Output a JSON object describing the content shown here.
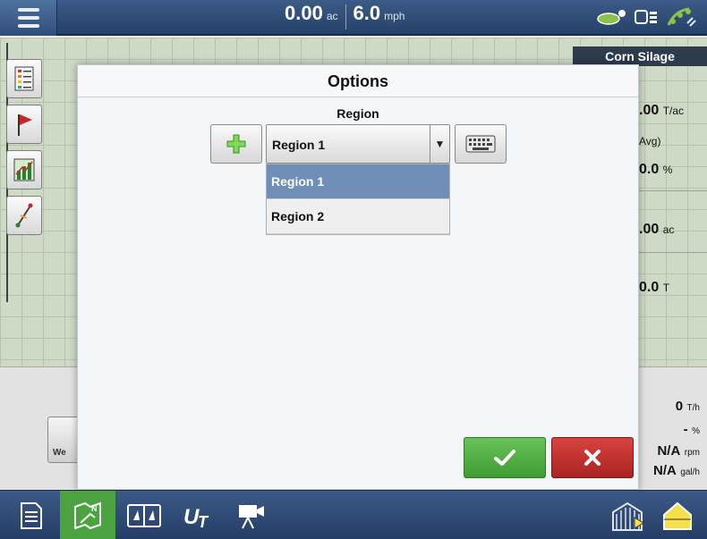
{
  "topbar": {
    "area_value": "0.00",
    "area_unit": "ac",
    "speed_value": "6.0",
    "speed_unit": "mph"
  },
  "right_panel": {
    "crop": "Corn Silage",
    "rows": [
      {
        "value": ".00",
        "unit": "T/ac"
      },
      {
        "value": "Avg)",
        "unit": ""
      },
      {
        "value": "0.0",
        "unit": "%"
      },
      {
        "value": ".00",
        "unit": "ac"
      },
      {
        "value": "0.0",
        "unit": "T"
      }
    ]
  },
  "bottom_stats": [
    {
      "value": "0",
      "unit": "T/h"
    },
    {
      "value": "-",
      "unit": "%"
    },
    {
      "value": "N/A",
      "unit": "rpm"
    },
    {
      "value": "N/A",
      "unit": "gal/h"
    }
  ],
  "weather_button": {
    "label": "We"
  },
  "dialog": {
    "title": "Options",
    "region_label": "Region",
    "region_selected": "Region 1",
    "region_options": [
      "Region 1",
      "Region 2"
    ]
  },
  "colors": {
    "ok": "#4caf3f",
    "cancel": "#c0302c",
    "selected_option": "#6f8fb9",
    "active_nav": "#4aa33e"
  },
  "icons": {
    "menu": "hamburger-icon",
    "add": "plus-icon",
    "keyboard": "keyboard-icon",
    "ok": "checkmark-icon",
    "cancel": "x-icon"
  }
}
